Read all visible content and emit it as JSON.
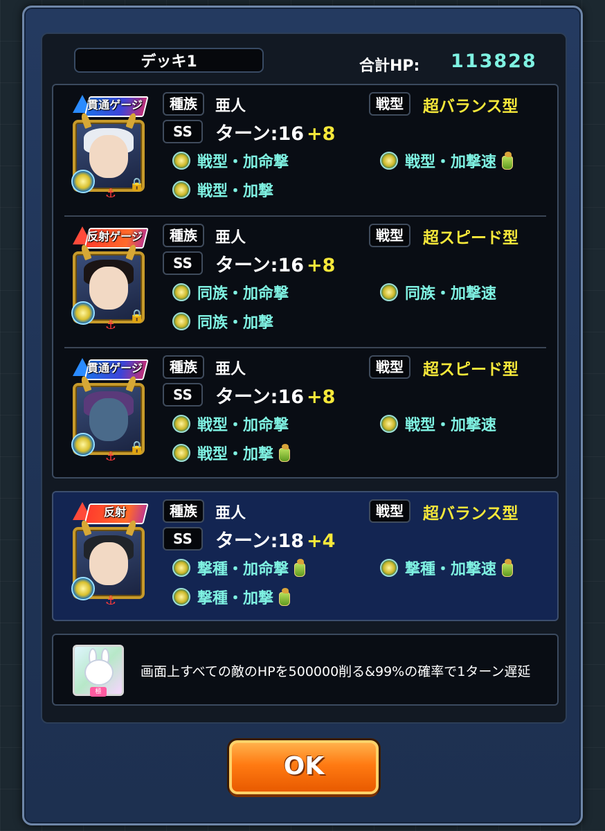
{
  "deck": {
    "title": "デッキ1",
    "hp_label": "合計HP:",
    "hp_value": "113828"
  },
  "monsters": [
    {
      "gauge": "貫通ゲージ",
      "race_label": "種族",
      "race": "亜人",
      "type_label": "戦型",
      "type": "超バランス型",
      "ss_label": "SS",
      "turn": "ターン:16",
      "turn_bonus": "+8",
      "abilities": [
        "戦型・加命撃",
        "戦型・加撃速",
        "戦型・加撃"
      ]
    },
    {
      "gauge": "反射ゲージ",
      "race_label": "種族",
      "race": "亜人",
      "type_label": "戦型",
      "type": "超スピード型",
      "ss_label": "SS",
      "turn": "ターン:16",
      "turn_bonus": "+8",
      "abilities": [
        "同族・加命撃",
        "同族・加撃速",
        "同族・加撃"
      ]
    },
    {
      "gauge": "貫通ゲージ",
      "race_label": "種族",
      "race": "亜人",
      "type_label": "戦型",
      "type": "超スピード型",
      "ss_label": "SS",
      "turn": "ターン:16",
      "turn_bonus": "+8",
      "abilities": [
        "戦型・加命撃",
        "戦型・加撃速",
        "戦型・加撃"
      ]
    },
    {
      "gauge": "反射",
      "race_label": "種族",
      "race": "亜人",
      "type_label": "戦型",
      "type": "超バランス型",
      "ss_label": "SS",
      "turn": "ターン:18",
      "turn_bonus": "+4",
      "abilities": [
        "撃種・加命撃",
        "撃種・加撃速",
        "撃種・加撃"
      ]
    }
  ],
  "item": {
    "description": "画面上すべての敵のHPを500000削る&99%の確率で1ターン遅延",
    "badge": "極"
  },
  "ok_label": "OK"
}
